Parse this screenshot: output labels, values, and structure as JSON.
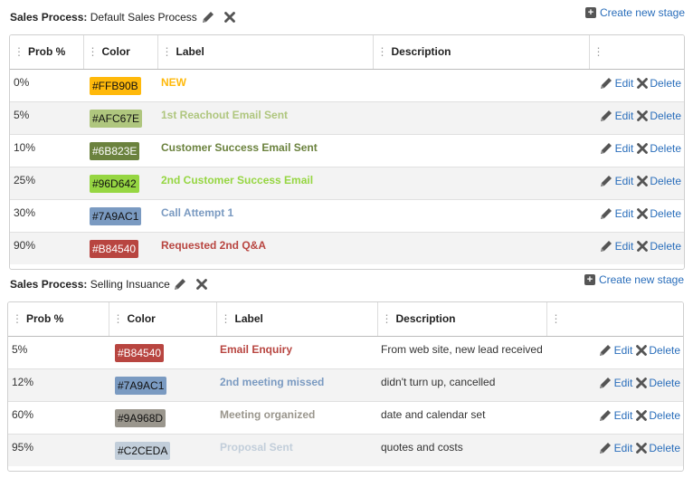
{
  "process1": {
    "label": "Sales Process:",
    "name": "Default Sales Process",
    "create_label": "Create new stage",
    "columns": [
      "Prob %",
      "Color",
      "Label",
      "Description",
      ""
    ],
    "rows": [
      {
        "prob": "0%",
        "color": "#FFB90B",
        "label": "NEW",
        "description": "",
        "edit": "Edit",
        "delete": "Delete"
      },
      {
        "prob": "5%",
        "color": "#AFC67E",
        "label": "1st Reachout Email Sent",
        "description": "",
        "edit": "Edit",
        "delete": "Delete"
      },
      {
        "prob": "10%",
        "color": "#6B823E",
        "label": "Customer Success Email Sent",
        "description": "",
        "edit": "Edit",
        "delete": "Delete"
      },
      {
        "prob": "25%",
        "color": "#96D642",
        "label": "2nd Customer Success Email",
        "description": "",
        "edit": "Edit",
        "delete": "Delete"
      },
      {
        "prob": "30%",
        "color": "#7A9AC1",
        "label": "Call Attempt 1",
        "description": "",
        "edit": "Edit",
        "delete": "Delete"
      },
      {
        "prob": "90%",
        "color": "#B84540",
        "label": "Requested 2nd Q&A",
        "description": "",
        "edit": "Edit",
        "delete": "Delete"
      }
    ]
  },
  "process2": {
    "label": "Sales Process:",
    "name": "Selling Insuance",
    "create_label": "Create new stage",
    "columns": [
      "Prob %",
      "Color",
      "Label",
      "Description",
      ""
    ],
    "rows": [
      {
        "prob": "5%",
        "color": "#B84540",
        "label": "Email Enquiry",
        "description": "From web site, new lead received",
        "edit": "Edit",
        "delete": "Delete"
      },
      {
        "prob": "12%",
        "color": "#7A9AC1",
        "label": "2nd meeting missed",
        "description": "didn't turn up, cancelled",
        "edit": "Edit",
        "delete": "Delete"
      },
      {
        "prob": "60%",
        "color": "#9A968D",
        "label": "Meeting organized",
        "description": "date and calendar set",
        "edit": "Edit",
        "delete": "Delete"
      },
      {
        "prob": "95%",
        "color": "#C2CEDA",
        "label": "Proposal Sent",
        "description": "quotes and costs",
        "edit": "Edit",
        "delete": "Delete"
      }
    ]
  },
  "theme": {
    "link": "#2a6ebb",
    "icon": "#555555"
  }
}
